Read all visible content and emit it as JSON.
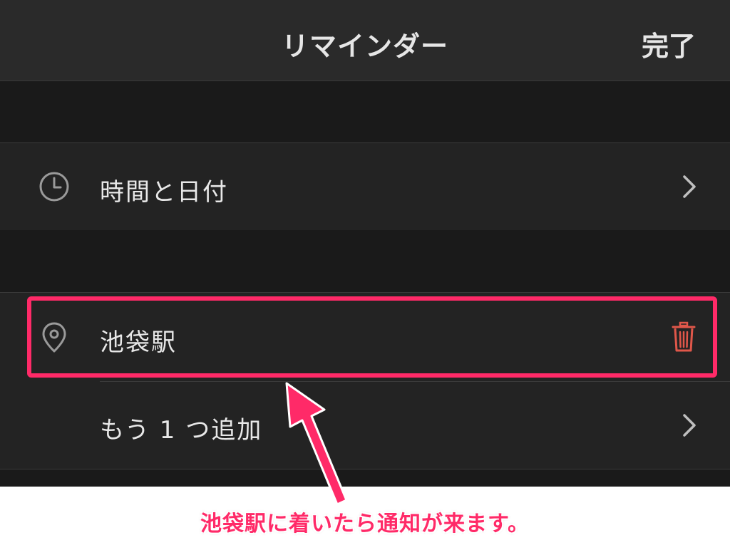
{
  "navbar": {
    "title": "リマインダー",
    "done_label": "完了"
  },
  "rows": {
    "time_date": {
      "label": "時間と日付",
      "icon": "clock-icon"
    },
    "location": {
      "label": "池袋駅",
      "icon": "location-pin-icon",
      "action_icon": "trash-icon"
    },
    "add_another": {
      "label": "もう 1 つ追加"
    }
  },
  "annotation": {
    "text": "池袋駅に着いたら通知が来ます。"
  },
  "colors": {
    "accent_highlight": "#ff2a68",
    "trash": "#e0574a",
    "background": "#1a1a1a",
    "cell": "#232323",
    "navbar": "#2a2a2a",
    "text": "#e8e8e8"
  }
}
